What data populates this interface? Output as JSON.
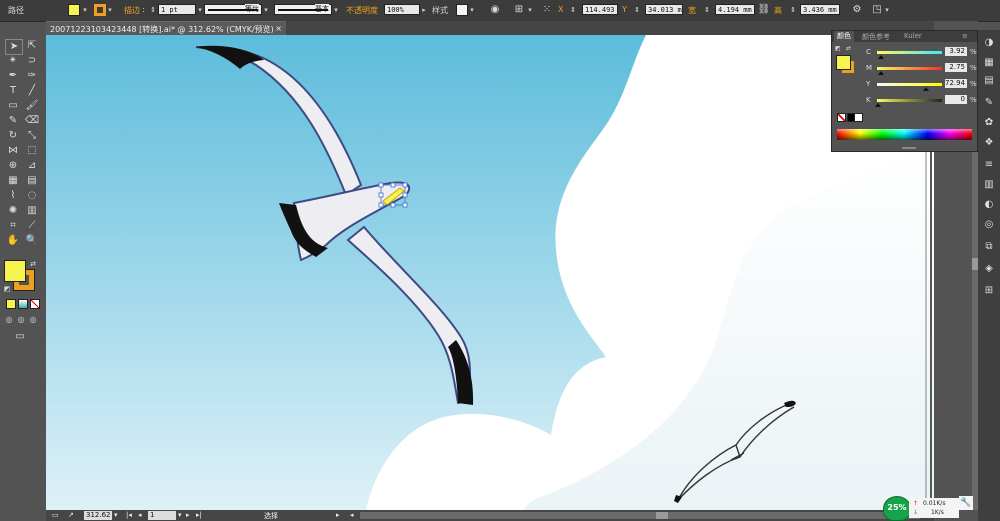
{
  "control_bar": {
    "object_type": "路径",
    "stroke_label": "描边",
    "stroke_weight": "1 pt",
    "profile_label": "等比",
    "brush_label": "基本",
    "opacity_label": "不透明度",
    "opacity_value": "100%",
    "style_label": "样式",
    "x_label": "X",
    "x_value": "114.493 r",
    "y_label": "Y",
    "y_value": "34.013 mm",
    "w_label": "宽",
    "w_value": "4.194 mm",
    "h_label": "高",
    "h_value": "3.436 mm",
    "fill_color": "#f7f450",
    "stroke_color": "#f0a020"
  },
  "document_tab": {
    "title": "20071223103423448 [转换].ai* @ 312.62% (CMYK/预览)",
    "close": "×"
  },
  "color_panel": {
    "tabs": [
      "颜色",
      "颜色参考",
      "Kuler"
    ],
    "fill_color": "#f7f450",
    "sliders": [
      {
        "label": "C",
        "value": "3.92",
        "unit": "%",
        "percent": 3.92
      },
      {
        "label": "M",
        "value": "2.75",
        "unit": "%",
        "percent": 2.75
      },
      {
        "label": "Y",
        "value": "72.94",
        "unit": "%",
        "percent": 72.94
      },
      {
        "label": "K",
        "value": "0",
        "unit": "%",
        "percent": 0
      }
    ]
  },
  "status_bar": {
    "zoom": "312.62",
    "page": "1",
    "tool_name": "选择"
  },
  "net_widget": {
    "percent": "25%",
    "upload": "0.01K/s",
    "download": "1K/s"
  },
  "toolbox": {
    "fill_color": "#f7f450",
    "stroke_color": "#f0a020"
  }
}
